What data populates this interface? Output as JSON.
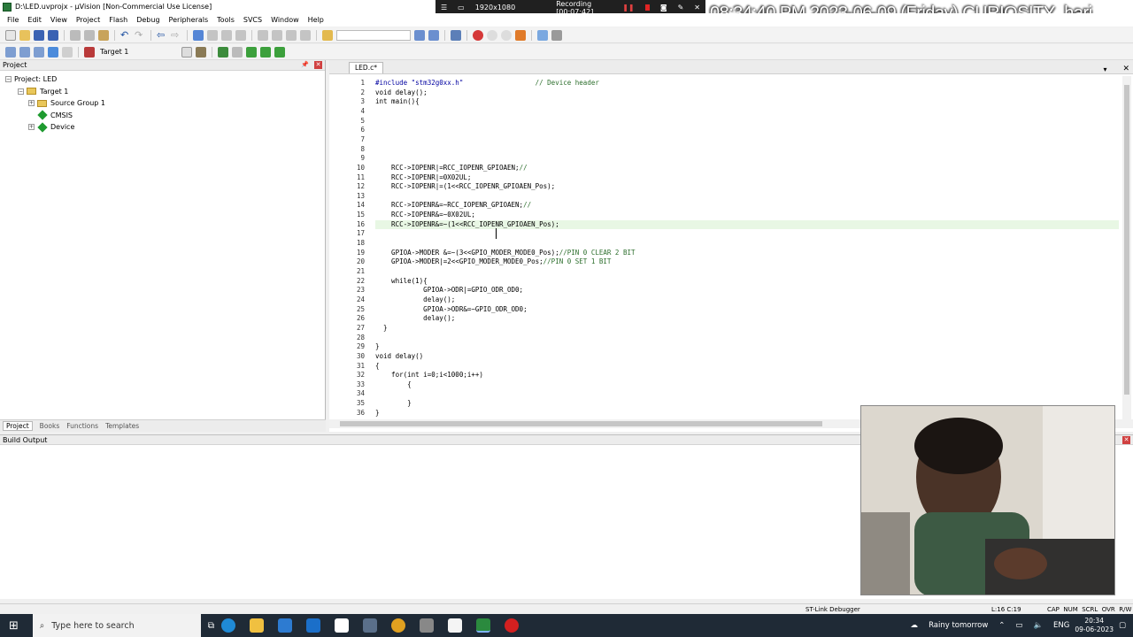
{
  "window": {
    "title": "D:\\LED.uvprojx - µVision  [Non-Commercial Use License]"
  },
  "menu": [
    "File",
    "Edit",
    "View",
    "Project",
    "Flash",
    "Debug",
    "Peripherals",
    "Tools",
    "SVCS",
    "Window",
    "Help"
  ],
  "recorder": {
    "resolution": "1920x1080",
    "status": "Recording [00:07:42]"
  },
  "overlay_text": "08:34:40 PM  2023-06-09 (Friday) CURIOSITY_hari",
  "toolbar2": {
    "target": "Target 1"
  },
  "project_panel": {
    "header": "Project",
    "tree": [
      {
        "label": "Project: LED",
        "level": 0,
        "expander": "−",
        "icon": "none"
      },
      {
        "label": "Target 1",
        "level": 1,
        "expander": "−",
        "icon": "folder"
      },
      {
        "label": "Source Group 1",
        "level": 2,
        "expander": "+",
        "icon": "folder"
      },
      {
        "label": "CMSIS",
        "level": 2,
        "expander": "",
        "icon": "diamond"
      },
      {
        "label": "Device",
        "level": 2,
        "expander": "+",
        "icon": "diamond"
      }
    ],
    "tabs": [
      "Project",
      "Books",
      "Functions",
      "Templates"
    ]
  },
  "editor": {
    "tab": "LED.c*",
    "lines": [
      {
        "n": 1,
        "text": "#include \"stm32g0xx.h\"                  // Device header"
      },
      {
        "n": 2,
        "text": "void delay();"
      },
      {
        "n": 3,
        "text": "int main(){"
      },
      {
        "n": 4,
        "text": ""
      },
      {
        "n": 5,
        "text": ""
      },
      {
        "n": 6,
        "text": ""
      },
      {
        "n": 7,
        "text": ""
      },
      {
        "n": 8,
        "text": ""
      },
      {
        "n": 9,
        "text": ""
      },
      {
        "n": 10,
        "text": "    RCC->IOPENR|=RCC_IOPENR_GPIOAEN;//"
      },
      {
        "n": 11,
        "text": "    RCC->IOPENR|=0X02UL;"
      },
      {
        "n": 12,
        "text": "    RCC->IOPENR|=(1<<RCC_IOPENR_GPIOAEN_Pos);"
      },
      {
        "n": 13,
        "text": ""
      },
      {
        "n": 14,
        "text": "    RCC->IOPENR&=~RCC_IOPENR_GPIOAEN;//"
      },
      {
        "n": 15,
        "text": "    RCC->IOPENR&=~0X02UL;"
      },
      {
        "n": 16,
        "text": "    RCC->IOPENR&=~(1<<RCC_IOPENR_GPIOAEN_Pos);"
      },
      {
        "n": 17,
        "text": ""
      },
      {
        "n": 18,
        "text": ""
      },
      {
        "n": 19,
        "text": "    GPIOA->MODER &=~(3<<GPIO_MODER_MODE0_Pos);//PIN 0 CLEAR 2 BIT"
      },
      {
        "n": 20,
        "text": "    GPIOA->MODER|=2<<GPIO_MODER_MODE0_Pos;//PIN 0 SET 1 BIT"
      },
      {
        "n": 21,
        "text": ""
      },
      {
        "n": 22,
        "text": "    while(1){"
      },
      {
        "n": 23,
        "text": "            GPIOA->ODR|=GPIO_ODR_OD0;"
      },
      {
        "n": 24,
        "text": "            delay();"
      },
      {
        "n": 25,
        "text": "            GPIOA->ODR&=~GPIO_ODR_OD0;"
      },
      {
        "n": 26,
        "text": "            delay();"
      },
      {
        "n": 27,
        "text": "  }"
      },
      {
        "n": 28,
        "text": ""
      },
      {
        "n": 29,
        "text": "}"
      },
      {
        "n": 30,
        "text": "void delay()"
      },
      {
        "n": 31,
        "text": "{"
      },
      {
        "n": 32,
        "text": "    for(int i=0;i<1000;i++)"
      },
      {
        "n": 33,
        "text": "        {"
      },
      {
        "n": 34,
        "text": ""
      },
      {
        "n": 35,
        "text": "        }"
      },
      {
        "n": 36,
        "text": "}"
      }
    ],
    "highlight_line": 16
  },
  "build_output": {
    "header": "Build Output"
  },
  "status": {
    "debugger": "ST-Link Debugger",
    "position": "L:16 C:19",
    "flags": "CAP  NUM  SCRL  OVR  R/W"
  },
  "taskbar": {
    "search_placeholder": "Type here to search",
    "weather": "Rainy tomorrow",
    "lang": "ENG",
    "time": "20:34",
    "date": "09-06-2023"
  }
}
